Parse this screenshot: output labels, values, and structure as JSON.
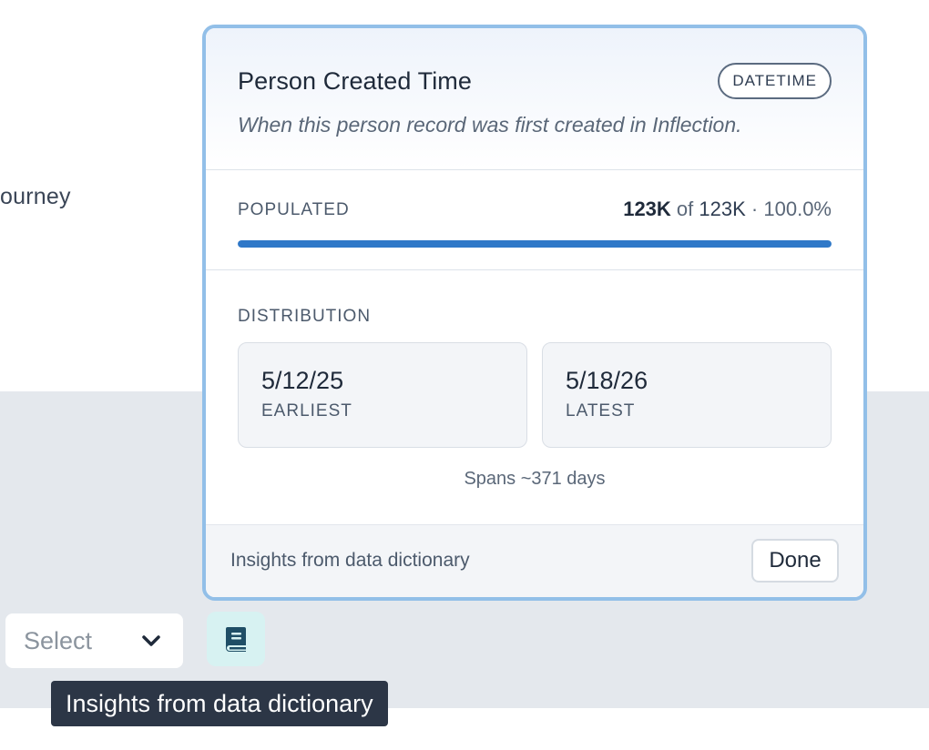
{
  "background": {
    "journey_text": "ourney",
    "select": {
      "value": "Select"
    },
    "tooltip": "Insights from data dictionary"
  },
  "popover": {
    "title": "Person Created Time",
    "type_badge": "DATETIME",
    "description": "When this person record was first created in Inflection.",
    "populated": {
      "label": "POPULATED",
      "count": "123K",
      "of_word": "of",
      "total": "123K",
      "separator": "·",
      "percent": "100.0%",
      "fraction": 1.0
    },
    "distribution": {
      "label": "DISTRIBUTION",
      "earliest": {
        "value": "5/12/25",
        "label": "EARLIEST"
      },
      "latest": {
        "value": "5/18/26",
        "label": "LATEST"
      },
      "span": "Spans ~371 days"
    },
    "footer": {
      "text": "Insights from data dictionary",
      "done_label": "Done"
    }
  },
  "icons": {
    "dictionary": "book-icon",
    "select_chevron": "chevron-down-icon"
  },
  "colors": {
    "accent": "#2f78c8",
    "popover_border": "#92bfe8",
    "dictionary_button_bg": "#d7f2f2",
    "dictionary_icon": "#1f4e66",
    "tooltip_bg": "#2c3646"
  }
}
